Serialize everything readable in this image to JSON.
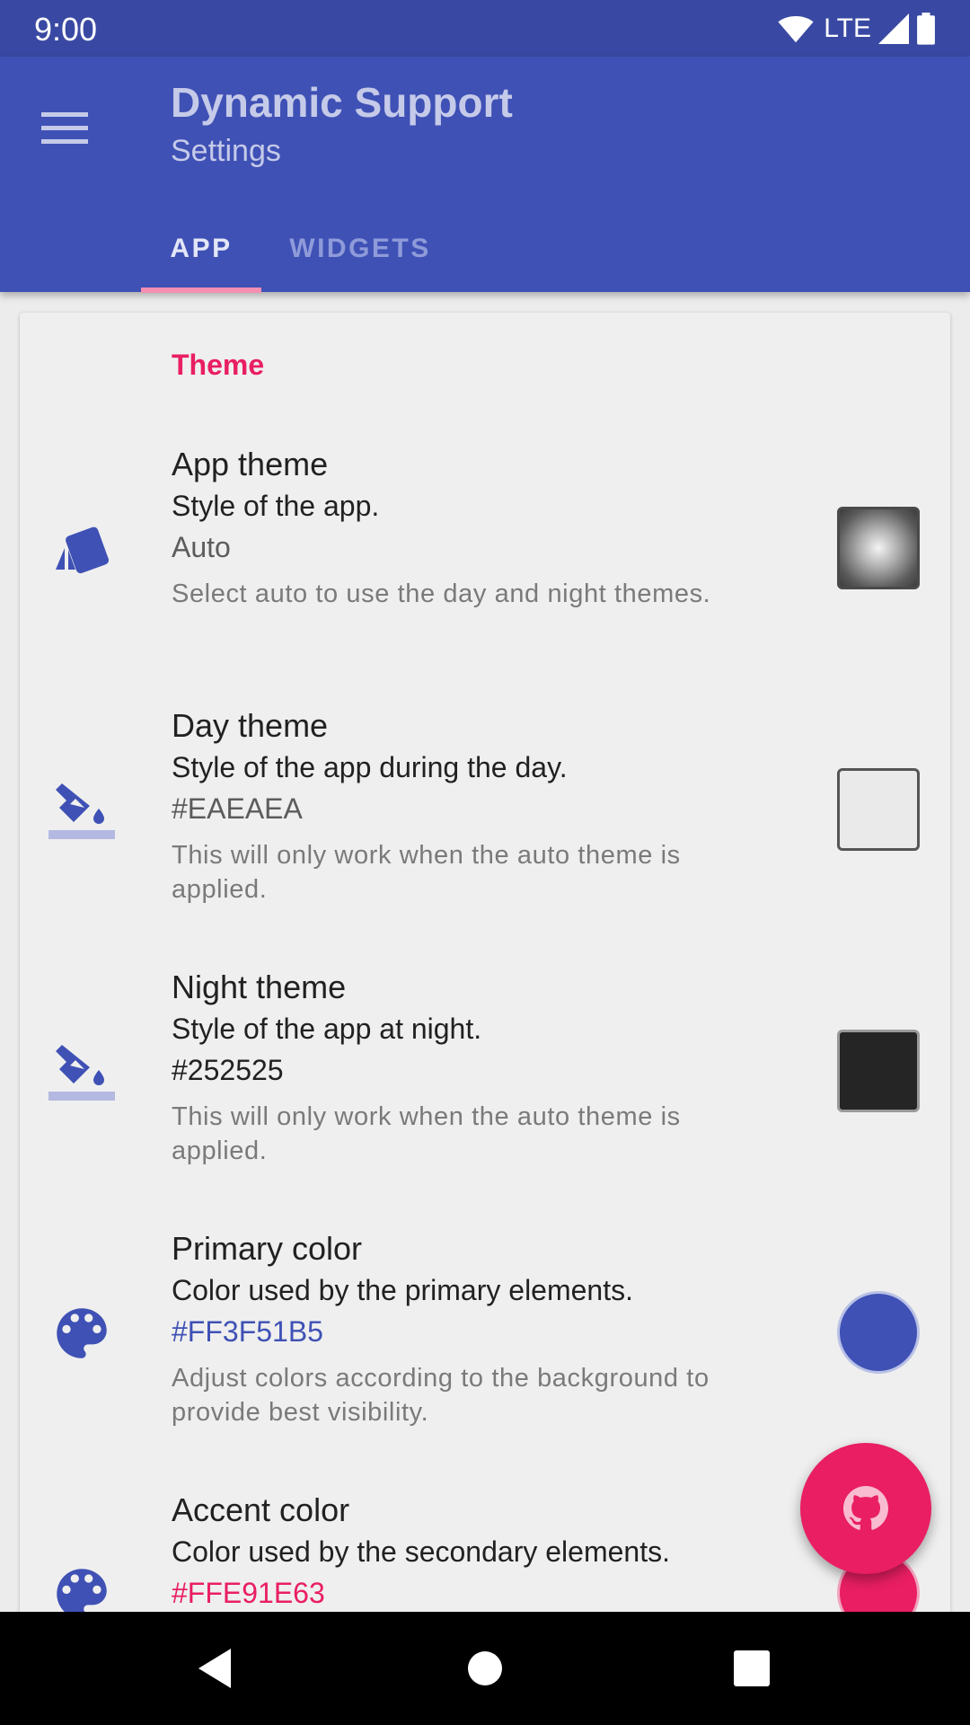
{
  "status_bar": {
    "time": "9:00",
    "network": "LTE"
  },
  "app_bar": {
    "title": "Dynamic Support",
    "subtitle": "Settings",
    "menu_icon": "menu-icon"
  },
  "tabs": [
    {
      "label": "APP",
      "selected": true
    },
    {
      "label": "WIDGETS",
      "selected": false
    }
  ],
  "section": {
    "title": "Theme"
  },
  "preferences": [
    {
      "icon": "theme-cards-icon",
      "title": "App theme",
      "summary": "Style of the app.",
      "value": "Auto",
      "description": "Select auto to use the day and night themes."
    },
    {
      "icon": "format-color-fill-icon",
      "title": "Day theme",
      "summary": "Style of the app during the day.",
      "value": "#EAEAEA",
      "description": "This will only work when the auto theme is applied."
    },
    {
      "icon": "format-color-fill-icon",
      "title": "Night theme",
      "summary": "Style of the app at night.",
      "value": "#252525",
      "description": "This will only work when the auto theme is applied."
    },
    {
      "icon": "palette-icon",
      "title": "Primary color",
      "summary": "Color used by the primary elements.",
      "value": "#FF3F51B5",
      "description": "Adjust colors according to the background to provide best visibility."
    },
    {
      "icon": "palette-icon",
      "title": "Accent color",
      "summary": "Color used by the secondary elements.",
      "value": "#FFE91E63",
      "description": ""
    }
  ],
  "colors": {
    "primary": "#3f51b5",
    "accent": "#e91e63",
    "day_swatch": "#eaeaea",
    "night_swatch": "#252525"
  },
  "fab": {
    "icon": "github-icon"
  },
  "nav_bar": {
    "back_icon": "back-icon",
    "home_icon": "home-icon",
    "recents_icon": "recents-icon"
  }
}
